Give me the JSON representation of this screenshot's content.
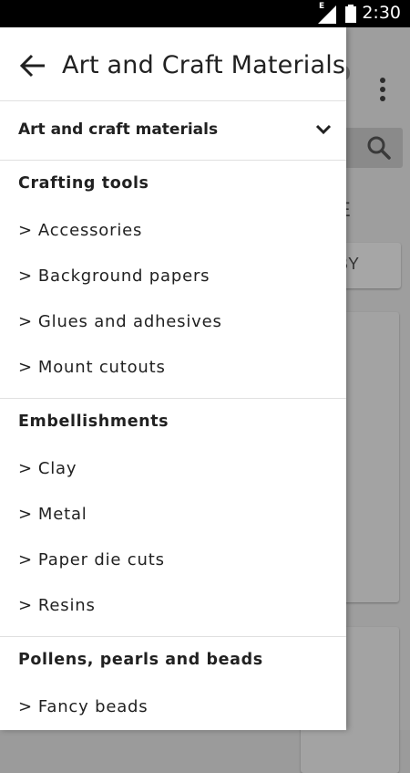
{
  "status_bar": {
    "time": "2:30",
    "network_label": "E",
    "icons": [
      "signal-icon",
      "battery-icon"
    ]
  },
  "background": {
    "sort_label": "BY",
    "partial_text": "E",
    "icons": [
      "overflow-menu-icon",
      "search-icon"
    ]
  },
  "drawer": {
    "back_icon": "arrow-left-icon",
    "title": "Art and Craft Materials",
    "category": {
      "label": "Art and craft materials",
      "icon": "chevron-down-icon"
    },
    "item_prefix": ">",
    "sections": [
      {
        "title": "Crafting tools",
        "items": [
          "Accessories",
          "Background papers",
          "Glues and adhesives",
          "Mount cutouts"
        ]
      },
      {
        "title": "Embellishments",
        "items": [
          "Clay",
          "Metal",
          "Paper die cuts",
          "Resins"
        ]
      },
      {
        "title": "Pollens, pearls and beads",
        "items": [
          "Fancy beads"
        ]
      }
    ]
  },
  "colors": {
    "status_bar": "#000000",
    "drawer_bg": "#ffffff",
    "scrim": "#9e9e9e",
    "text": "#212121",
    "divider": "#e0e0e0"
  }
}
